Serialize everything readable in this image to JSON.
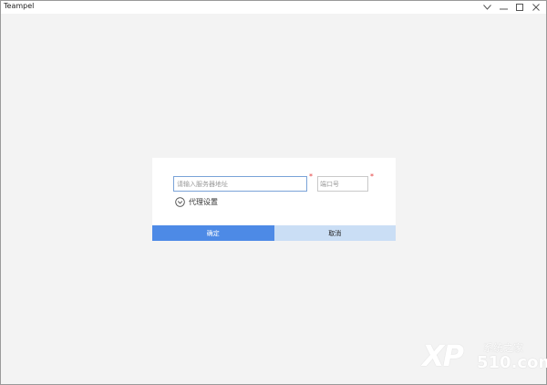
{
  "window": {
    "title": "Teampel"
  },
  "form": {
    "server_placeholder": "请输入服务器地址",
    "port_placeholder": "端口号",
    "required_mark": "*",
    "proxy_label": "代理设置",
    "ok_label": "确定",
    "cancel_label": "取消"
  },
  "watermark": {
    "brand": "XP",
    "line1": "系统之家",
    "line2": "510.com"
  },
  "colors": {
    "accent": "#4d8ae6",
    "cancel_bg": "#cadef5",
    "required": "#e53b3b",
    "window_bg": "#f3f3f3"
  }
}
